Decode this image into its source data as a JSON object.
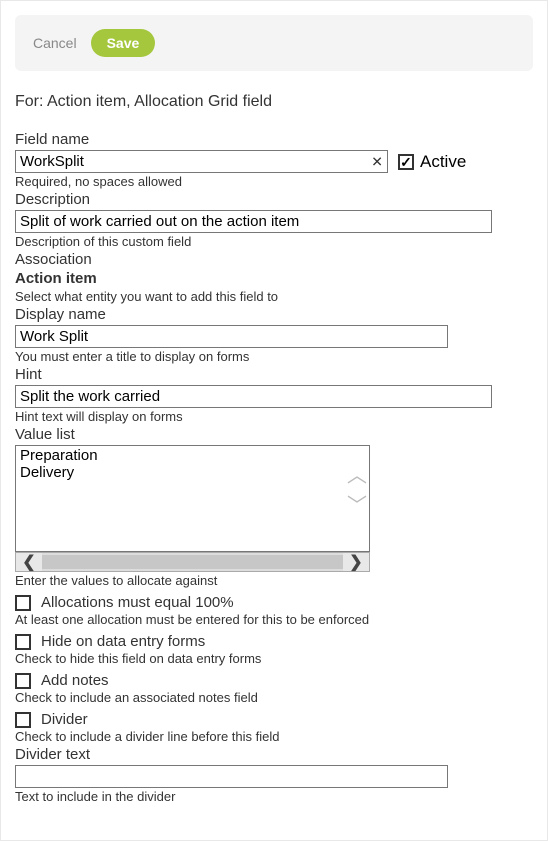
{
  "header": {
    "cancel": "Cancel",
    "save": "Save"
  },
  "context": "For: Action item, Allocation Grid field",
  "fieldName": {
    "label": "Field name",
    "value": "WorkSplit",
    "helper": "Required, no spaces allowed"
  },
  "active": {
    "label": "Active",
    "checked": "✓"
  },
  "description": {
    "label": "Description",
    "value": "Split of work carried out on the action item",
    "helper": "Description of this custom field"
  },
  "association": {
    "label": "Association",
    "value": "Action item",
    "helper": "Select what entity you want to add this field to"
  },
  "displayName": {
    "label": "Display name",
    "value": "Work Split",
    "helper": "You must enter a title to display on forms"
  },
  "hint": {
    "label": "Hint",
    "value": "Split the work carried",
    "helper": "Hint text will display on forms"
  },
  "valueList": {
    "label": "Value list",
    "lines": "Preparation\nDelivery",
    "helper": "Enter the values to allocate against"
  },
  "options": {
    "alloc100": {
      "label": "Allocations must equal 100%",
      "helper": "At least one allocation must be entered for this to be enforced"
    },
    "hide": {
      "label": "Hide on data entry forms",
      "helper": "Check to hide this field on data entry forms"
    },
    "notes": {
      "label": "Add notes",
      "helper": "Check to include an associated notes field"
    },
    "divider": {
      "label": "Divider",
      "helper": "Check to include a divider line before this field"
    }
  },
  "dividerText": {
    "label": "Divider text",
    "value": "",
    "helper": "Text to include in the divider"
  }
}
